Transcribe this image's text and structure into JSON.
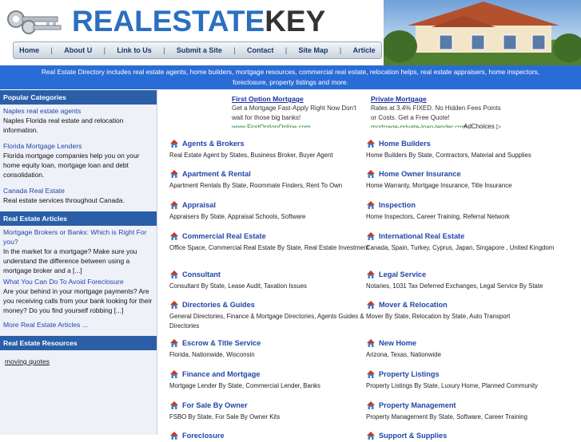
{
  "header": {
    "logo_part1": "REALESTATE",
    "logo_part2": "KEY"
  },
  "nav": {
    "items": [
      "Home",
      "About U",
      "Link to Us",
      "Submit a Site",
      "Contact",
      "Site Map",
      "Article"
    ]
  },
  "banner": {
    "line1": "Real Estate Directory includes real estate agents, home builders, mortgage resources, commercial real estate, relocation helps, real estate appraisers, home inspectors,",
    "line2": "foreclosure, property listings and more."
  },
  "sidebar": {
    "popular_heading": "Popular Categories",
    "popular": [
      {
        "link": "Naples real estate agents",
        "text": "Naples Florida real estate and relocation information."
      },
      {
        "link": "Florida Mortgage Lenders",
        "text": "Florida mortgage companies help you on your home equity loan, mortgage loan and debt consolidation."
      },
      {
        "link": "Canada Real Estate",
        "text": "Real estate services throughout Canada."
      }
    ],
    "articles_heading": "Real Estate Articles",
    "articles": [
      {
        "link": "Mortgage Brokers or Banks: Which is Right For you?",
        "text": "In the market for a mortgage? Make sure you understand the difference between using a mortgage broker and a [...]"
      },
      {
        "link": "What You Can Do To Avoid Foreclosure",
        "text": "Are your behind in your mortgage payments? Are you receiving calls from your bank looking for their money? Do you find yourself robbing [...]"
      }
    ],
    "more_articles": "More Real Estate Articles ...",
    "resources_heading": "Real Estate Resources",
    "resources_link": "moving quotes"
  },
  "ads": [
    {
      "title": "First Option Mortgage",
      "text": "Get a Mortgage Fast-Apply Right Now Don't wait for those big banks!",
      "url": "www.FirstOptionOnline.com"
    },
    {
      "title": "Private Mortgage",
      "text": "Rates at 3.4% FIXED. No Hidden Fees Points or Costs. Get a Free Quote!",
      "url": "mortgage-private-loan-lender.com"
    }
  ],
  "adchoices": "AdChoices",
  "categories_left": [
    {
      "title": "Agents & Brokers",
      "sub": "Real Estate Agent by States, Business Broker, Buyer Agent"
    },
    {
      "title": "Apartment & Rental",
      "sub": "Apartment Rentals By State, Roommate Finders, Rent To Own"
    },
    {
      "title": "Appraisal",
      "sub": "Appraisers By State, Appraisal Schools, Software"
    },
    {
      "title": "Commercial Real Estate",
      "sub": "Office Space, Commercial Real Estate By State, Real Estate Investment"
    },
    {
      "title": "Consultant",
      "sub": "Consultant By State, Lease Audit, Taxation Issues"
    },
    {
      "title": "Directories & Guides",
      "sub": "General Directories, Finance & Mortgage Directories, Agents Guides & Directories"
    },
    {
      "title": "Escrow & Title Service",
      "sub": "Florida, Nationwide, Wisconsin"
    },
    {
      "title": "Finance and Mortgage",
      "sub": "Mortgage Lender By State, Commercial Lender, Banks"
    },
    {
      "title": "For Sale By Owner",
      "sub": "FSBO By State, For Sale By Owner Kits"
    },
    {
      "title": "Foreclosure",
      "sub": ""
    }
  ],
  "categories_right": [
    {
      "title": "Home Builders",
      "sub": "Home Builders By State, Contractors, Material and Supplies"
    },
    {
      "title": "Home Owner Insurance",
      "sub": "Home Warranty, Mortgage Insurance, Title Insurance"
    },
    {
      "title": "Inspection",
      "sub": "Home Inspectors, Career Training, Referral Network"
    },
    {
      "title": "International Real Estate",
      "sub": "Canada, Spain, Turkey, Cyprus, Japan, Singapore , United Kingdom"
    },
    {
      "title": "Legal Service",
      "sub": "Notaries, 1031 Tax Deferred Exchanges, Legal Service By State"
    },
    {
      "title": "Mover & Relocation",
      "sub": "Mover By State, Relocation by State, Auto Transport"
    },
    {
      "title": "New Home",
      "sub": "Arizona, Texas, Nationwide"
    },
    {
      "title": "Property Listings",
      "sub": "Property Listings By State, Luxury Home, Planned Community"
    },
    {
      "title": "Property Management",
      "sub": "Property Management By State, Software, Career Training"
    },
    {
      "title": "Support & Supplies",
      "sub": ""
    }
  ],
  "colors": {
    "brand_blue": "#2b6fc0",
    "band_blue": "#2a6cd6",
    "link_blue": "#2046a8",
    "sidebar_head": "#2a5fa8"
  }
}
